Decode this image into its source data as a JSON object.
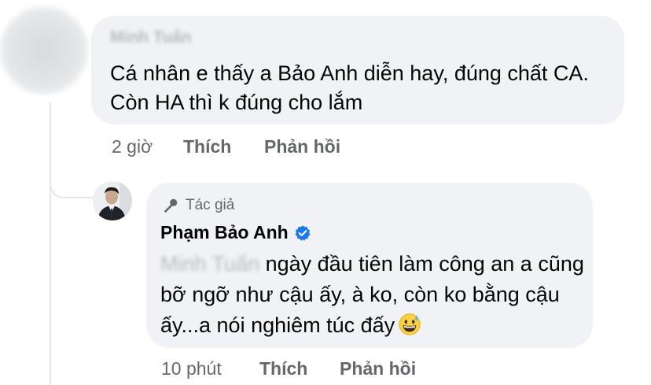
{
  "comment": {
    "author_blurred": "Minh Tuấn",
    "text": "Cá nhân e thấy a Bảo Anh diễn hay, đúng chất CA. Còn HA thì k đúng cho lắm",
    "time": "2 giờ",
    "like_label": "Thích",
    "reply_label": "Phản hồi"
  },
  "reply": {
    "badge_label": "Tác giả",
    "author": "Phạm Bảo Anh",
    "mention_blurred": "Minh Tuấn",
    "text": " ngày đầu tiên làm công an a cũng bỡ ngỡ như cậu ấy, à ko, còn ko bằng cậu ấy...a nói nghiêm túc đấy",
    "emoji": "grinning-face-with-sweat",
    "time": "10 phút",
    "like_label": "Thích",
    "reply_label": "Phản hồi"
  },
  "colors": {
    "bubble": "#f0f2f5",
    "meta_text": "#65676b",
    "text": "#050505",
    "verified": "#1877f2"
  }
}
